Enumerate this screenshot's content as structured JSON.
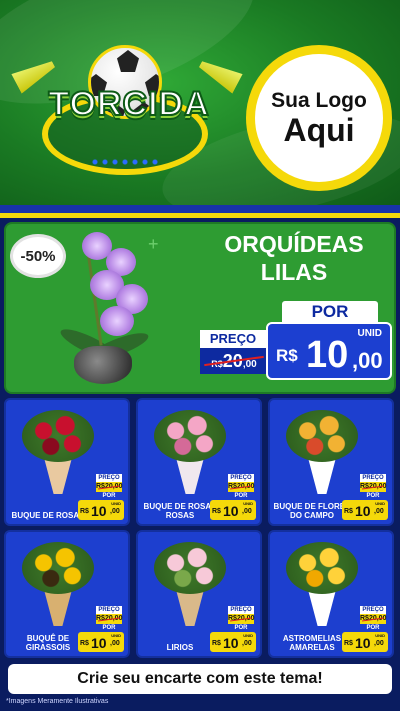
{
  "header": {
    "brand_word": "TORCIDA",
    "logo_line1": "Sua Logo",
    "logo_line2": "Aqui"
  },
  "hero": {
    "discount": "-50%",
    "title": "ORQUÍDEAS LILAS",
    "preco_label": "PREÇO",
    "old_currency": "R$",
    "old_value": "20",
    "old_cents": ",00",
    "por_label": "POR",
    "unid_label": "UNID",
    "new_currency": "R$",
    "new_value": "10",
    "new_cents": ",00"
  },
  "products": [
    {
      "name": "BUQUE DE ROSAS",
      "preco": "PREÇO",
      "old": "R$20,00",
      "por": "POR",
      "unid": "UNID",
      "rs": "R$",
      "value": "10",
      "cents": ",00"
    },
    {
      "name": "BUQUE DE ROSAS ROSAS",
      "preco": "PREÇO",
      "old": "R$20,00",
      "por": "POR",
      "unid": "UNID",
      "rs": "R$",
      "value": "10",
      "cents": ",00"
    },
    {
      "name": "BUQUE DE FLORES DO CAMPO",
      "preco": "PREÇO",
      "old": "R$20,00",
      "por": "POR",
      "unid": "UNID",
      "rs": "R$",
      "value": "10",
      "cents": ",00"
    },
    {
      "name": "BUQUÊ DE GIRASSOIS",
      "preco": "PREÇO",
      "old": "R$20,00",
      "por": "POR",
      "unid": "UNID",
      "rs": "R$",
      "value": "10",
      "cents": ",00"
    },
    {
      "name": "LIRIOS",
      "preco": "PREÇO",
      "old": "R$20,00",
      "por": "POR",
      "unid": "UNID",
      "rs": "R$",
      "value": "10",
      "cents": ",00"
    },
    {
      "name": "ASTROMELIAS AMARELAS",
      "preco": "PREÇO",
      "old": "R$20,00",
      "por": "POR",
      "unid": "UNID",
      "rs": "R$",
      "value": "10",
      "cents": ",00"
    }
  ],
  "cta": "Crie seu encarte com este tema!",
  "footnote": "*Imagens Meramente Ilustrativas",
  "colors": {
    "green": "#2e9c32",
    "blue": "#1d3fcf",
    "navy": "#0a1c60",
    "yellow": "#f5d90a",
    "strike_red": "#e02020"
  },
  "icons": [
    "soccer-ball-icon",
    "vuvuzela-horn-icon",
    "orchid-image",
    "bouquet-image"
  ]
}
